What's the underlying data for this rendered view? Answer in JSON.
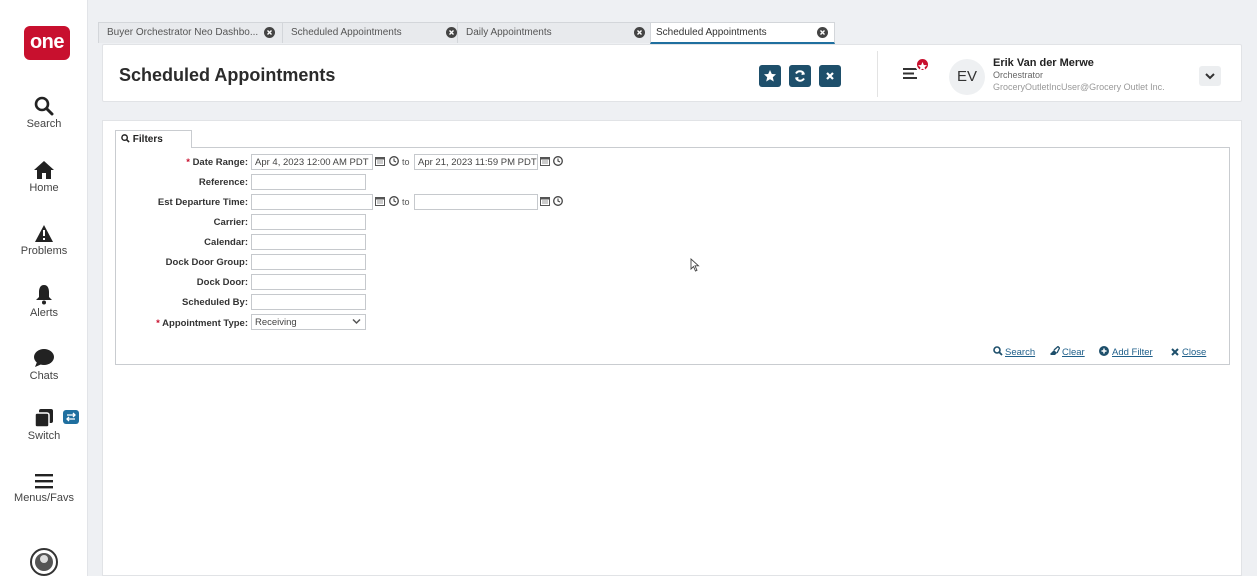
{
  "app": {
    "logo_text": "one",
    "brand_color": "#c8102e",
    "accent_color": "#1e4f6b"
  },
  "sidebar": {
    "items": [
      {
        "label": "Search",
        "icon": "search-icon"
      },
      {
        "label": "Home",
        "icon": "home-icon"
      },
      {
        "label": "Problems",
        "icon": "warning-icon"
      },
      {
        "label": "Alerts",
        "icon": "bell-icon"
      },
      {
        "label": "Chats",
        "icon": "chat-icon"
      },
      {
        "label": "Switch",
        "icon": "switch-icon"
      },
      {
        "label": "Menus/Favs",
        "icon": "menu-icon"
      }
    ]
  },
  "tabs": [
    {
      "label": "Buyer Orchestrator Neo Dashbo...",
      "active": false
    },
    {
      "label": "Scheduled Appointments",
      "active": false
    },
    {
      "label": "Daily Appointments",
      "active": false
    },
    {
      "label": "Scheduled Appointments",
      "active": true
    }
  ],
  "header": {
    "title": "Scheduled Appointments",
    "buttons": [
      "star-icon",
      "refresh-icon",
      "close-icon"
    ]
  },
  "user": {
    "initials": "EV",
    "name": "Erik Van der Merwe",
    "role": "Orchestrator",
    "email": "GroceryOutletIncUser@Grocery Outlet Inc."
  },
  "filters": {
    "tab_label": "Filters",
    "to_text": "to",
    "fields": {
      "date_range": {
        "label": "Date Range:",
        "required": "*",
        "from": "Apr 4, 2023 12:00 AM PDT",
        "to": "Apr 21, 2023 11:59 PM PDT"
      },
      "reference": {
        "label": "Reference:",
        "value": ""
      },
      "est_departure": {
        "label": "Est Departure Time:",
        "from": "",
        "to": ""
      },
      "carrier": {
        "label": "Carrier:",
        "value": ""
      },
      "calendar": {
        "label": "Calendar:",
        "value": ""
      },
      "dock_door_group": {
        "label": "Dock Door Group:",
        "value": ""
      },
      "dock_door": {
        "label": "Dock Door:",
        "value": ""
      },
      "scheduled_by": {
        "label": "Scheduled By:",
        "value": ""
      },
      "appointment_type": {
        "label": "Appointment Type:",
        "required": "*",
        "value": "Receiving"
      }
    },
    "actions": {
      "search": "Search",
      "clear": "Clear",
      "add_filter": "Add Filter",
      "close": "Close"
    }
  }
}
